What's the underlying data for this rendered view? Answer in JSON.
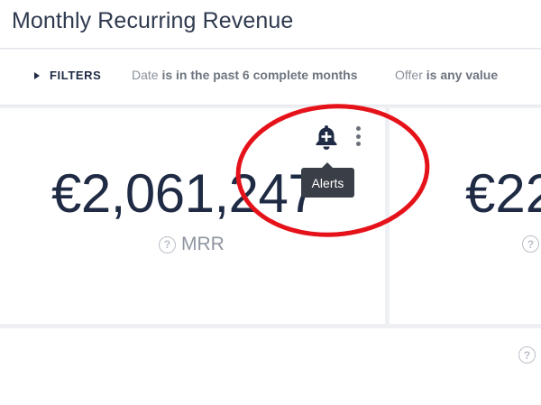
{
  "header": {
    "title": "Monthly Recurring Revenue"
  },
  "filters": {
    "toggle_label": "FILTERS",
    "chips": [
      {
        "field": "Date",
        "condition": "is in the past 6 complete months"
      },
      {
        "field": "Offer",
        "condition": "is any value"
      }
    ]
  },
  "main_card": {
    "value": "€2,061,247",
    "label": "MRR",
    "help_icon": "?",
    "alert_icon": "bell-plus-icon",
    "more_icon": "vertical-dots-icon",
    "tooltip": "Alerts"
  },
  "right_card": {
    "value": "€22",
    "help_icon": "?"
  },
  "bottom_card": {
    "help_icon": "?"
  },
  "colors": {
    "annotation": "#e5121a",
    "text_primary": "#1f2b44",
    "tooltip_bg": "#3a3f47"
  }
}
